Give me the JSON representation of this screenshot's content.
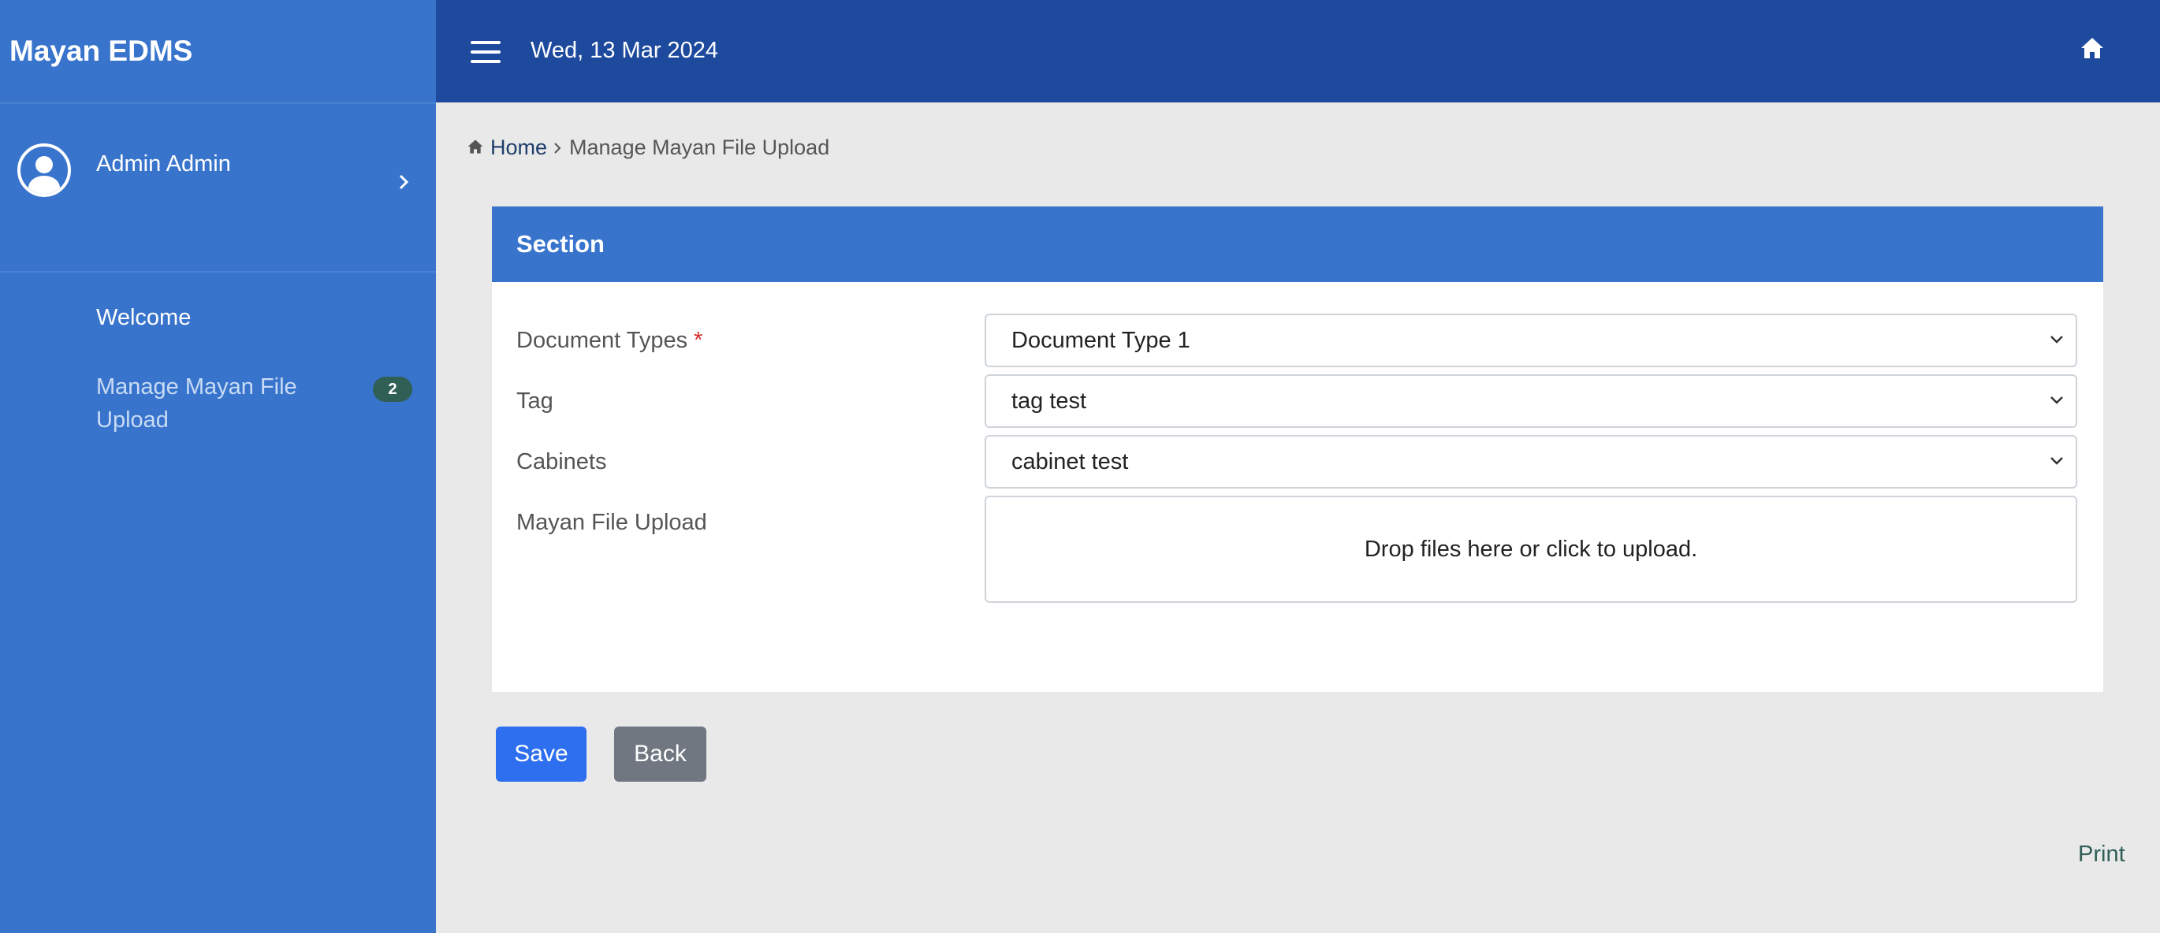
{
  "sidebar": {
    "brand": "Mayan EDMS",
    "user_name": "Admin Admin",
    "nav": [
      {
        "label": "Welcome"
      },
      {
        "label": "Manage Mayan File Upload",
        "badge": "2"
      }
    ]
  },
  "topbar": {
    "date": "Wed, 13 Mar 2024"
  },
  "breadcrumb": {
    "home": "Home",
    "current": "Manage Mayan File Upload"
  },
  "form": {
    "section_title": "Section",
    "document_types": {
      "label": "Document Types",
      "required_mark": "*",
      "value": "Document Type 1"
    },
    "tag": {
      "label": "Tag",
      "value": "tag test"
    },
    "cabinets": {
      "label": "Cabinets",
      "value": "cabinet test"
    },
    "file_upload": {
      "label": "Mayan File Upload",
      "dropzone_text": "Drop files here or click to upload."
    }
  },
  "actions": {
    "save": "Save",
    "back": "Back",
    "print": "Print"
  },
  "colors": {
    "sidebar": "#3874cc",
    "topbar": "#1e4a9e",
    "save_button": "#2e6fef",
    "back_button": "#707780"
  }
}
